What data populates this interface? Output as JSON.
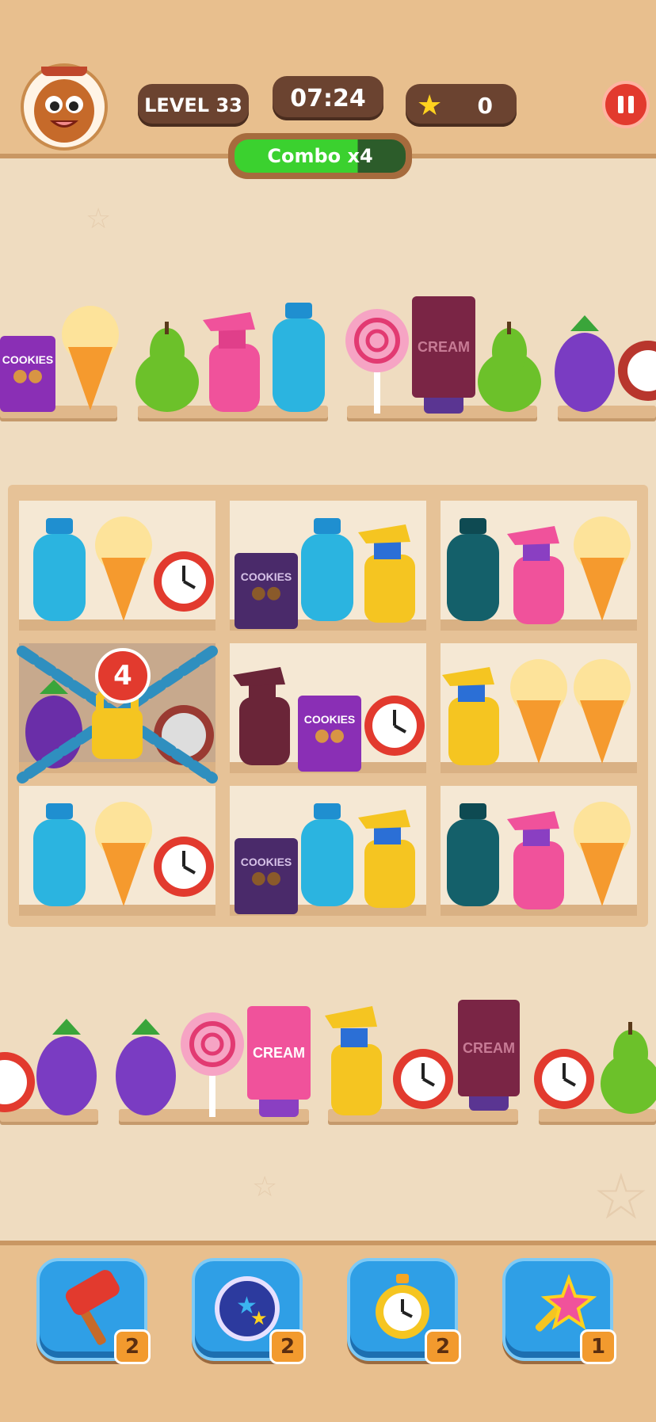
{
  "hud": {
    "level_label": "LEVEL 33",
    "timer": "07:24",
    "stars": "0",
    "combo": "Combo x4",
    "combo_progress": 0.72
  },
  "shelves": {
    "lock_count": "4",
    "cookies_label": "COOKIES",
    "cream_label": "CREAM"
  },
  "powerups": [
    {
      "name": "hammer",
      "count": "2"
    },
    {
      "name": "shuffle",
      "count": "2"
    },
    {
      "name": "freeze-timer",
      "count": "2"
    },
    {
      "name": "magic-wand",
      "count": "1"
    }
  ]
}
